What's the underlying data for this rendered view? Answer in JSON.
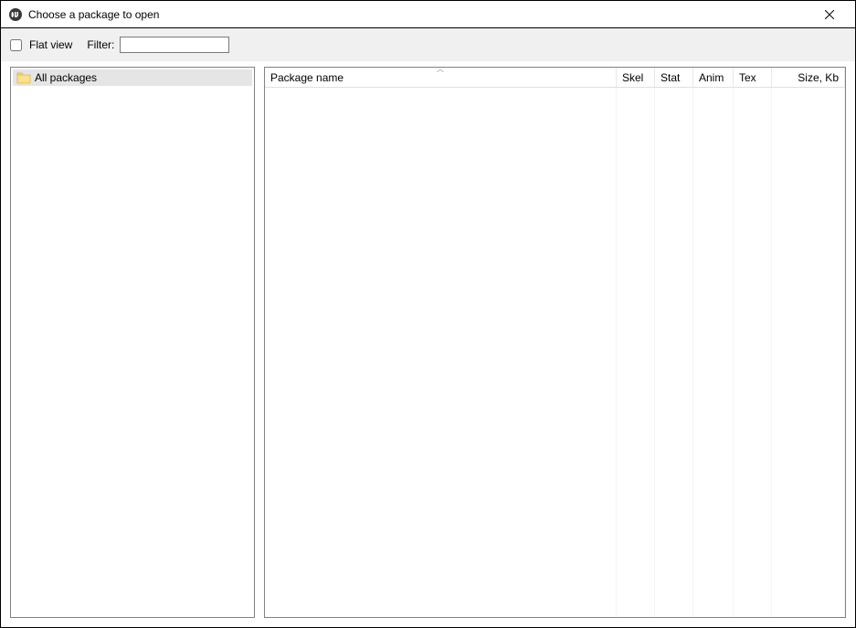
{
  "window": {
    "title": "Choose a package to open"
  },
  "toolbar": {
    "flat_view_label": "Flat view",
    "flat_view_checked": false,
    "filter_label": "Filter:",
    "filter_value": ""
  },
  "tree": {
    "items": [
      {
        "label": "All packages",
        "selected": true
      }
    ]
  },
  "list": {
    "columns": {
      "name": "Package name",
      "skel": "Skel",
      "stat": "Stat",
      "anim": "Anim",
      "tex": "Tex",
      "size": "Size, Kb"
    },
    "sort_column": "name",
    "sort_dir": "asc",
    "rows": []
  }
}
